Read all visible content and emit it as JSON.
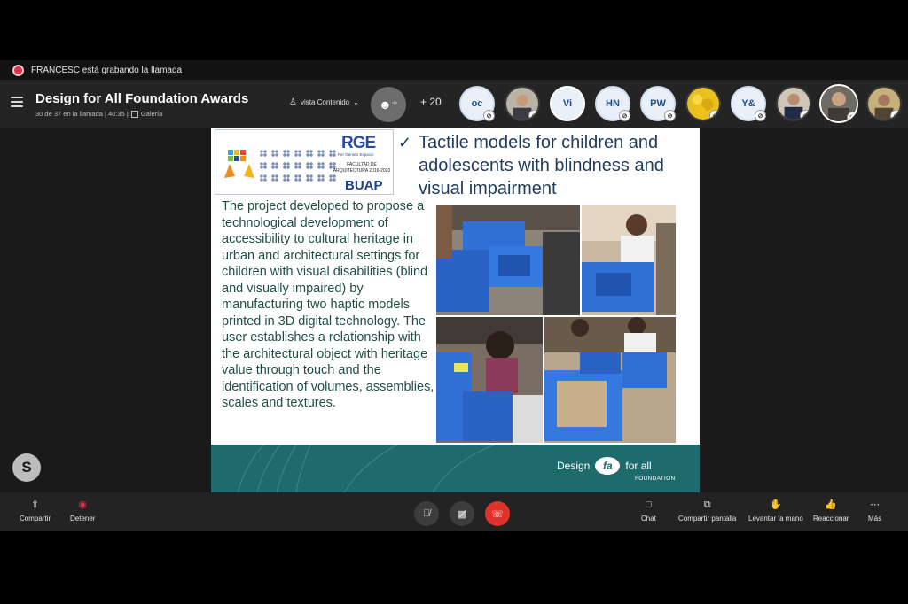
{
  "recording": {
    "text": "FRANCESC está grabando la llamada"
  },
  "call": {
    "title": "Design for All Foundation Awards",
    "subtitle": "30 de 37 en la llamada | 40:35 |",
    "gallery_label": "Galería",
    "view_label": "vista Contenido",
    "more_participants": "+ 20"
  },
  "participants": [
    {
      "label": "oc",
      "kind": "initials"
    },
    {
      "label": "",
      "kind": "photo"
    },
    {
      "label": "Vi",
      "kind": "initials"
    },
    {
      "label": "HN",
      "kind": "initials"
    },
    {
      "label": "PW",
      "kind": "initials"
    },
    {
      "label": "",
      "kind": "photo"
    },
    {
      "label": "Y&",
      "kind": "initials"
    },
    {
      "label": "",
      "kind": "photo"
    },
    {
      "label": "",
      "kind": "photo"
    },
    {
      "label": "",
      "kind": "photo"
    }
  ],
  "slide": {
    "logo": {
      "rge": "RGE",
      "rge_sub": "Per Genero Espacio",
      "faculty": "FACULTAD DE ARQUITECTURA 2016-2020",
      "buap": "BUAP"
    },
    "title": "Tactile models for children and adolescents with blindness and visual impairment",
    "body": "The project developed to propose a technological development of accessibility to cultural heritage in urban and architectural settings for children with visual disabilities (blind and visually impaired) by manufacturing two haptic models printed in 3D digital technology. The user establishes a relationship with the architectural object with heritage value through touch and the identification of volumes, assemblies, scales and textures.",
    "brand_left": "Design",
    "brand_mark": "fa",
    "brand_right": "for all",
    "brand_sub": "FOUNDATION"
  },
  "skype_logo": "S",
  "toolbar": {
    "share": "Compartir",
    "stop": "Detener",
    "chat": "Chat",
    "share_screen": "Compartir pantalla",
    "raise_hand": "Levantar la mano",
    "react": "Reaccionar",
    "more": "Más"
  },
  "colors": {
    "recording": "#e0314a",
    "end_call": "#e0322b",
    "slide_footer": "#1e6b6e",
    "slide_title": "#1f3b5c",
    "slide_body": "#1f4f46",
    "model_blue": "#2f6fd6"
  }
}
